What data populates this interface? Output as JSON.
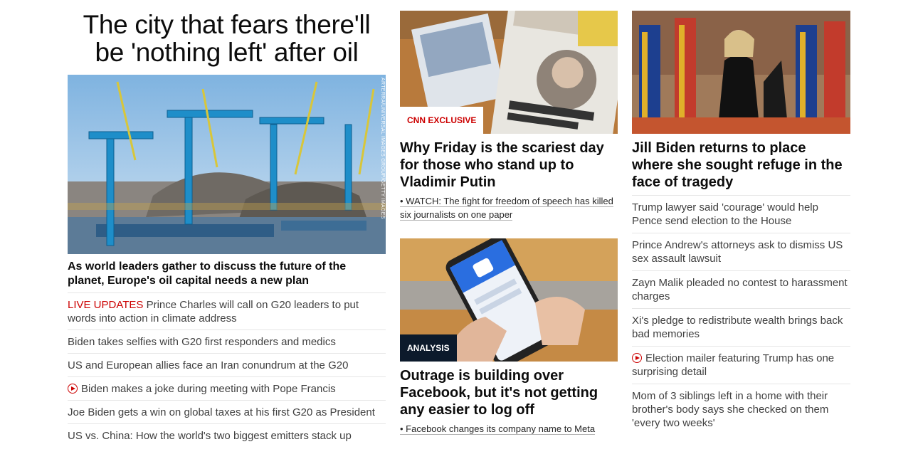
{
  "col1": {
    "headline": "The city that fears there'll be 'nothing left' after oil",
    "image_credit": "ARTERRA/UNIVERSAL IMAGES GROUP/GETTY IMAGES",
    "story_title": "As world leaders gather to discuss the future of the planet, Europe's oil capital needs a new plan",
    "list": [
      {
        "prefix": "LIVE UPDATES",
        "text": " Prince Charles will call on G20 leaders to put words into action in climate address"
      },
      {
        "text": "Biden takes selfies with G20 first responders and medics"
      },
      {
        "text": "US and European allies face an Iran conundrum at the G20"
      },
      {
        "video": true,
        "text": "Biden makes a joke during meeting with Pope Francis"
      },
      {
        "text": "Joe Biden gets a win on global taxes at his first G20 as President"
      },
      {
        "text": "US vs. China: How the world's two biggest emitters stack up"
      }
    ]
  },
  "col2": {
    "story1": {
      "label": "CNN EXCLUSIVE",
      "title": "Why Friday is the scariest day for those who stand up to Vladimir Putin",
      "sub": "• WATCH: The fight for freedom of speech has killed six journalists on one paper"
    },
    "story2": {
      "label": "ANALYSIS",
      "title": "Outrage is building over Facebook, but it's not getting any easier to log off",
      "sub": "• Facebook changes its company name to Meta"
    }
  },
  "col3": {
    "story_title": "Jill Biden returns to place where she sought refuge in the face of tragedy",
    "list": [
      {
        "text": "Trump lawyer said 'courage' would help Pence send election to the House"
      },
      {
        "text": "Prince Andrew's attorneys ask to dismiss US sex assault lawsuit"
      },
      {
        "text": "Zayn Malik pleaded no contest to harassment charges"
      },
      {
        "text": "Xi's pledge to redistribute wealth brings back bad memories"
      },
      {
        "video": true,
        "text": "Election mailer featuring Trump has one surprising detail"
      },
      {
        "text": "Mom of 3 siblings left in a home with their brother's body says she checked on them 'every two weeks'"
      }
    ]
  },
  "colors": {
    "accent_red": "#cc0000",
    "analysis_bg": "#0c1a2b"
  }
}
